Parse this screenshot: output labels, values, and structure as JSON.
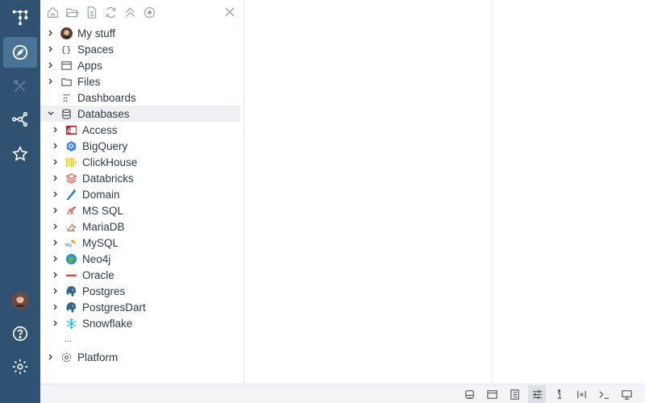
{
  "nav_rail": {
    "items": [
      {
        "name": "app-grid-icon"
      },
      {
        "name": "compass-icon",
        "active": true
      },
      {
        "name": "tools-icon"
      },
      {
        "name": "network-icon"
      },
      {
        "name": "star-icon"
      },
      {
        "name": "avatar"
      },
      {
        "name": "help-icon"
      },
      {
        "name": "gear-icon"
      }
    ]
  },
  "browser": {
    "toolbar": [
      "home-icon",
      "folder-open-icon",
      "file-icon",
      "refresh-icon",
      "collapse-icon",
      "target-icon"
    ],
    "tree": {
      "my_stuff": "My stuff",
      "spaces": "Spaces",
      "apps": "Apps",
      "files": "Files",
      "dashboards": "Dashboards",
      "databases": "Databases",
      "db_items": [
        {
          "label": "Access",
          "icon": "access-icon",
          "color": "#a4373a"
        },
        {
          "label": "BigQuery",
          "icon": "bigquery-icon",
          "color": "#4285f4"
        },
        {
          "label": "ClickHouse",
          "icon": "clickhouse-icon",
          "color": "#f5c400"
        },
        {
          "label": "Databricks",
          "icon": "databricks-icon",
          "color": "#e8473a"
        },
        {
          "label": "Domain",
          "icon": "domain-icon",
          "color": "#1e7cc8"
        },
        {
          "label": "MS SQL",
          "icon": "mssql-icon",
          "color": "#c8463a"
        },
        {
          "label": "MariaDB",
          "icon": "mariadb-icon",
          "color": "#b77a3f"
        },
        {
          "label": "MySQL",
          "icon": "mysql-icon",
          "color": "#00758f"
        },
        {
          "label": "Neo4j",
          "icon": "neo4j-icon",
          "color": "#2d8fd0"
        },
        {
          "label": "Oracle",
          "icon": "oracle-icon",
          "color": "#e03a2e"
        },
        {
          "label": "Postgres",
          "icon": "postgres-icon",
          "color": "#336791"
        },
        {
          "label": "PostgresDart",
          "icon": "postgres-icon",
          "color": "#336791"
        },
        {
          "label": "Snowflake",
          "icon": "snowflake-icon",
          "color": "#29b5e8"
        }
      ],
      "more": "...",
      "platform": "Platform"
    }
  },
  "statusbar": {
    "icons": [
      "storage-icon",
      "window-icon",
      "properties-icon",
      "settings-sliders-icon",
      "info-icon",
      "variables-icon",
      "console-icon",
      "presentation-icon"
    ],
    "active": "settings-sliders-icon"
  },
  "colors": {
    "rail": "#2f5272",
    "rail_active": "#4a7496",
    "selection": "#eef0f2"
  }
}
